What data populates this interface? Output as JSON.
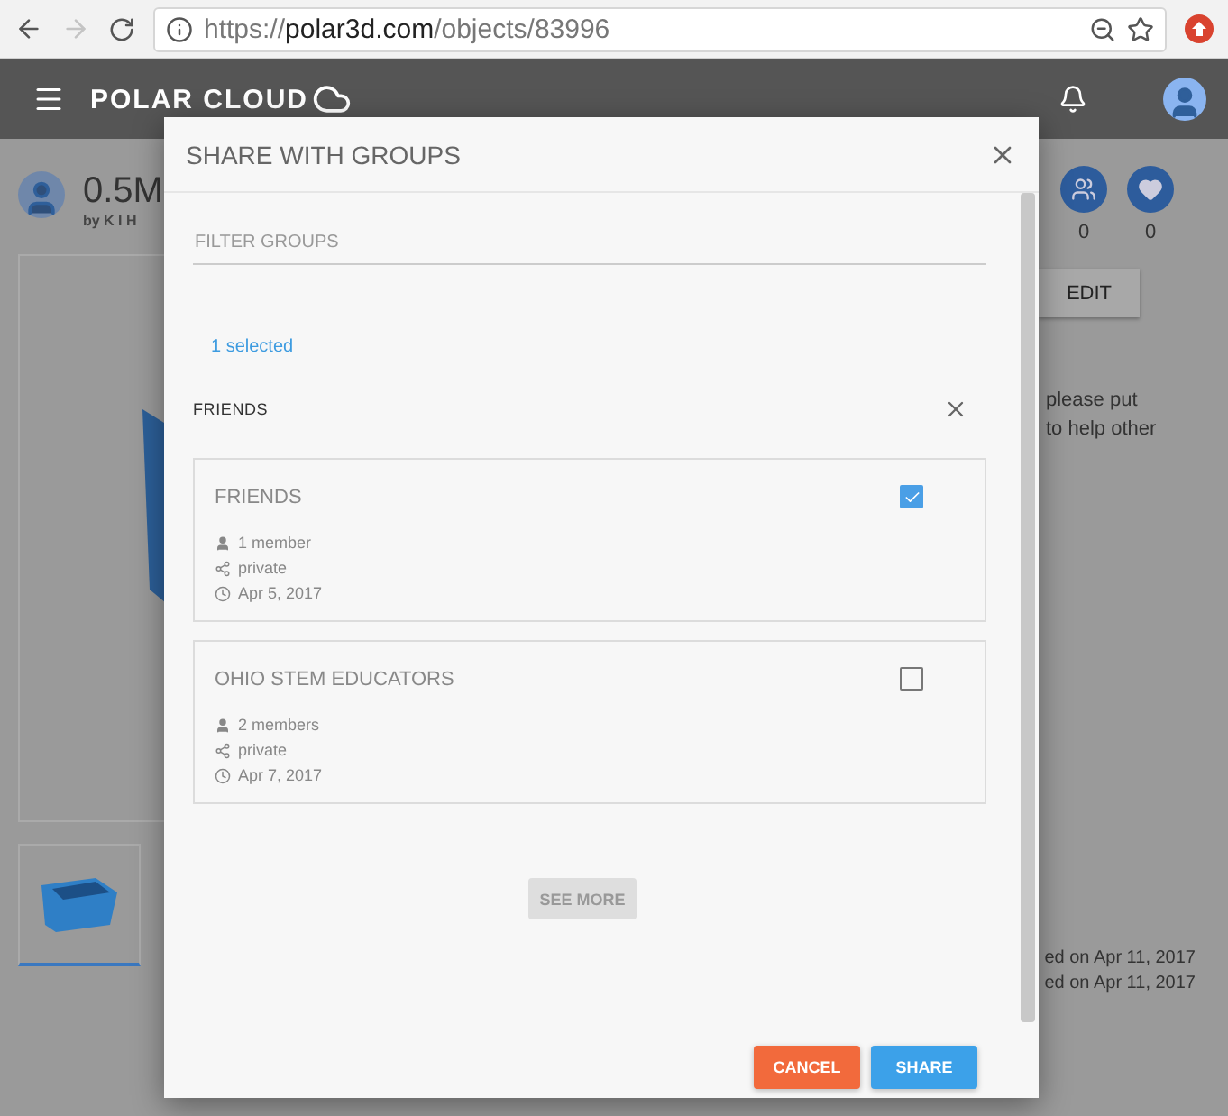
{
  "browser": {
    "scheme": "https://",
    "host": "polar3d.com",
    "path": "/objects/83996"
  },
  "app_bar": {
    "logo": "POLAR CLOUD"
  },
  "object": {
    "title": "0.5M",
    "author": "by K I H",
    "stats": [
      {
        "kind": "groups",
        "count": "0"
      },
      {
        "kind": "likes",
        "count": "0"
      }
    ],
    "edit": "EDIT",
    "description_lines": [
      "please put",
      "to help other"
    ],
    "dates": [
      "ed on Apr 11, 2017",
      "ed on Apr 11, 2017"
    ]
  },
  "dialog": {
    "title": "SHARE WITH GROUPS",
    "filter": {
      "placeholder": "FILTER GROUPS"
    },
    "selected_count": "1 selected",
    "chips": [
      {
        "label": "FRIENDS"
      }
    ],
    "groups": [
      {
        "name": "FRIENDS",
        "members": "1 member",
        "visibility": "private",
        "date": "Apr 5, 2017",
        "checked": true
      },
      {
        "name": "OHIO STEM EDUCATORS",
        "members": "2 members",
        "visibility": "private",
        "date": "Apr 7, 2017",
        "checked": false
      }
    ],
    "see_more": "SEE MORE",
    "buttons": [
      {
        "label": "CANCEL",
        "kind": "cancel"
      },
      {
        "label": "SHARE",
        "kind": "primary"
      }
    ]
  }
}
